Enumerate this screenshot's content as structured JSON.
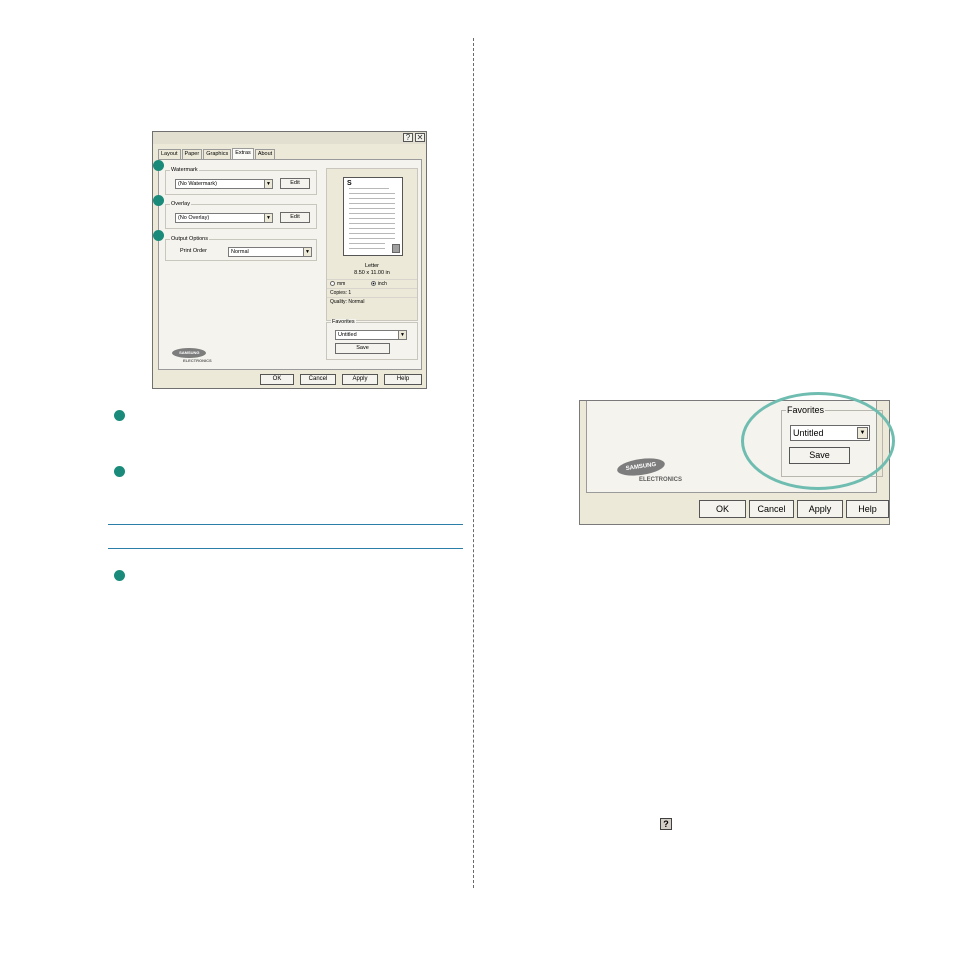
{
  "dialog": {
    "title_buttons": {
      "help": "?",
      "close": "✕"
    },
    "tabs": [
      "Layout",
      "Paper",
      "Graphics",
      "Extras",
      "About"
    ],
    "active_tab": "Extras",
    "watermark": {
      "label": "Watermark",
      "value": "(No Watermark)",
      "edit": "Edit"
    },
    "overlay": {
      "label": "Overlay",
      "value": "(No Overlay)",
      "edit": "Edit"
    },
    "output_options": {
      "label": "Output Options",
      "print_order_label": "Print Order",
      "print_order_value": "Normal"
    },
    "preview": {
      "page_letter": "S",
      "paper_name": "Letter",
      "paper_size": "8.50 x 11.00 in",
      "unit_mm": "mm",
      "unit_inch": "inch",
      "selected_unit": "inch",
      "copies": "Copies: 1",
      "quality": "Quality: Normal"
    },
    "favorites": {
      "label": "Favorites",
      "value": "Untitled",
      "save": "Save"
    },
    "logo": {
      "brand": "SAMSUNG",
      "sub": "ELECTRONICS"
    },
    "buttons": {
      "ok": "OK",
      "cancel": "Cancel",
      "apply": "Apply",
      "help": "Help"
    }
  },
  "zoom": {
    "favorites_label": "Favorites",
    "favorites_value": "Untitled",
    "save": "Save",
    "logo": {
      "brand": "SAMSUNG",
      "sub": "ELECTRONICS"
    },
    "buttons": {
      "ok": "OK",
      "cancel": "Cancel",
      "apply": "Apply",
      "help": "Help"
    }
  },
  "help_icon": "?",
  "colors": {
    "accent_teal": "#1a8b7a",
    "rule_blue": "#2a7ea8",
    "highlight_oval": "#6fbdb1",
    "dialog_bg": "#ece9d8"
  }
}
